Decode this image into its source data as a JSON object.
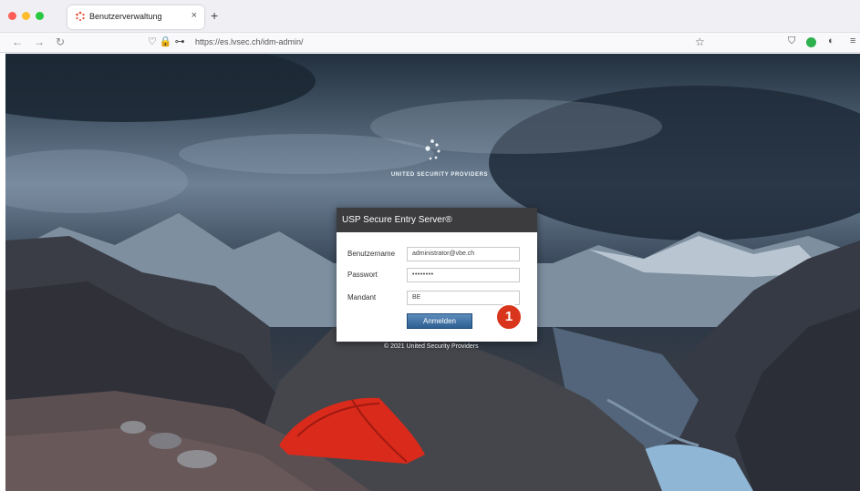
{
  "browser": {
    "tab_title": "Benutzerverwaltung",
    "tab_close": "×",
    "new_tab": "+",
    "url": "https://es.lvsec.ch/idm-admin/",
    "nav": {
      "back": "←",
      "forward": "→",
      "reload": "↻"
    },
    "address_icons": "♡  🔒  ⊶",
    "star": "☆",
    "right_icons": {
      "pocket": "⛉",
      "mask": "◐",
      "menu": "≡"
    }
  },
  "logo": {
    "text": "UNITED SECURITY PROVIDERS"
  },
  "login": {
    "title": "USP Secure Entry Server®",
    "fields": [
      {
        "label": "Benutzername",
        "value": "administrator@vbe.ch"
      },
      {
        "label": "Passwort",
        "value": "••••••••"
      },
      {
        "label": "Mandant",
        "value": "BE"
      }
    ],
    "submit_label": "Anmelden"
  },
  "callout": {
    "number": "1"
  },
  "footer": {
    "copyright": "© 2021 United Security Providers"
  },
  "colors": {
    "header": "#3c3c3e",
    "button": "#2e5f93",
    "callout": "#d9351c",
    "tent": "#d92a1c"
  }
}
